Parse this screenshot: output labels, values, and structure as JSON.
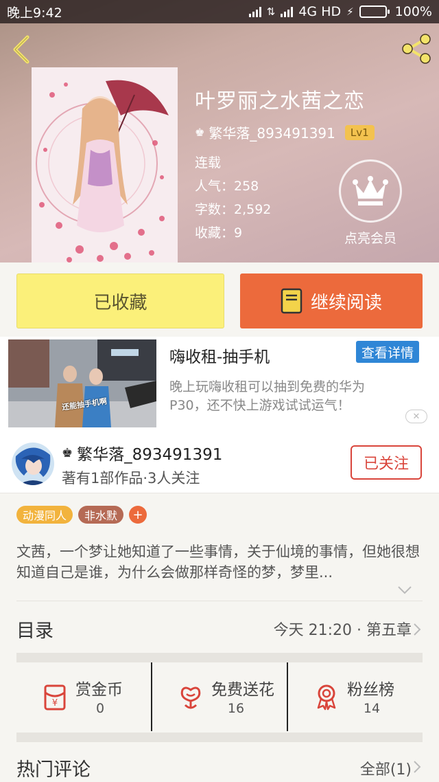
{
  "status_bar": {
    "time": "晚上9:42",
    "network": "4G HD",
    "battery": "100%"
  },
  "book": {
    "title": "叶罗丽之水茜之恋",
    "author": "繁华落_893491391",
    "level": "Lv1",
    "status": "连载",
    "popularity": "人气：258",
    "word_count": "字数：2,592",
    "favorites": "收藏：9"
  },
  "vip": {
    "label": "点亮会员"
  },
  "actions": {
    "collected_label": "已收藏",
    "read_label": "继续阅读"
  },
  "ad": {
    "title": "嗨收租-抽手机",
    "detail_label": "查看详情",
    "description": "晚上玩嗨收租可以抽到免费的华为P30，还不快上游戏试试运气！",
    "image_caption": "还能抽手机啊",
    "close_label": "✕"
  },
  "author_card": {
    "name": "繁华落_893491391",
    "summary": "著有1部作品·3人关注",
    "follow_label": "已关注"
  },
  "tags": [
    {
      "label": "动漫同人",
      "color": "#f2b33d"
    },
    {
      "label": "非水默",
      "color": "#b56a55"
    }
  ],
  "tag_add_label": "+",
  "description": "文茜，一个梦让她知道了一些事情，关于仙境的事情，但她很想知道自己是谁，为什么会做那样奇怪的梦，梦里...",
  "toc": {
    "label": "目录",
    "latest": "今天 21:20 · 第五章"
  },
  "stats": [
    {
      "label": "赏金币",
      "value": "0",
      "icon": "red-envelope-icon"
    },
    {
      "label": "免费送花",
      "value": "16",
      "icon": "flower-icon"
    },
    {
      "label": "粉丝榜",
      "value": "14",
      "icon": "medal-icon"
    }
  ],
  "comments": {
    "label": "热门评论",
    "all_label": "全部(1)"
  },
  "colors": {
    "accent_orange": "#ec6a3c",
    "collected_yellow": "#fbf07a",
    "follow_red": "#d9453b",
    "icon_red": "#d9453b"
  }
}
